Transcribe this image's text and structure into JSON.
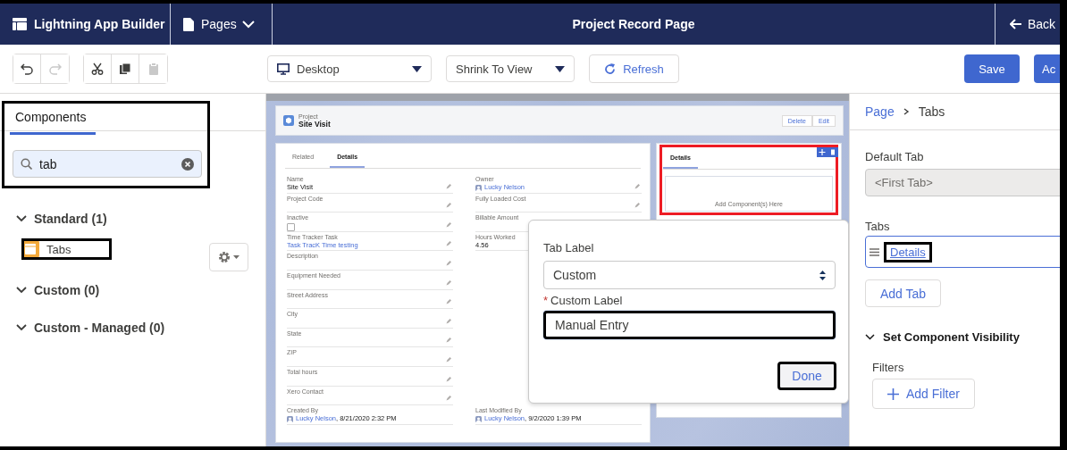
{
  "header": {
    "app_title": "Lightning App Builder",
    "pages_menu": "Pages",
    "page_title": "Project Record Page",
    "back": "Back"
  },
  "toolbar": {
    "undo_disabled": false,
    "redo_disabled": true,
    "cut_disabled": false,
    "copy_disabled": false,
    "paste_disabled": true,
    "device": "Desktop",
    "zoom": "Shrink To View",
    "refresh": "Refresh",
    "save": "Save",
    "activate": "Ac"
  },
  "components_panel": {
    "tab": "Components",
    "highlighted": true,
    "search": {
      "value": "tab"
    },
    "groups": [
      {
        "title": "Standard (1)",
        "expanded": true,
        "items": [
          {
            "label": "Tabs",
            "highlighted": true
          }
        ]
      },
      {
        "title": "Custom (0)",
        "expanded": true
      },
      {
        "title": "Custom - Managed (0)",
        "expanded": true
      }
    ]
  },
  "canvas": {
    "record": {
      "object": "Project",
      "name": "Site Visit",
      "actions": [
        "Delete",
        "Edit"
      ]
    },
    "main_tabs": [
      {
        "label": "Related",
        "selected": false
      },
      {
        "label": "Details",
        "selected": true
      }
    ],
    "rows": [
      {
        "left": {
          "label": "Name",
          "kind": "text",
          "value": "Site Visit",
          "editable": true
        },
        "right": {
          "label": "Owner",
          "kind": "owner",
          "value": "Lucky Nelson",
          "editable": true
        }
      },
      {
        "left": {
          "label": "Project Code",
          "kind": "text",
          "editable": true
        },
        "right": {
          "label": "Fully Loaded Cost",
          "kind": "text",
          "editable": true
        }
      },
      {
        "left": {
          "label": "Inactive",
          "kind": "checkbox",
          "checked": false,
          "editable": true
        },
        "right": {
          "label": "Billable Amount",
          "kind": "text"
        }
      },
      {
        "left": {
          "label": "Time Tracker Task",
          "kind": "link",
          "value": "Task TracK Time testing",
          "editable": true
        },
        "right": {
          "label": "Hours Worked",
          "kind": "text",
          "value": "4.56"
        }
      },
      {
        "left": {
          "label": "Description",
          "kind": "text",
          "editable": true
        }
      },
      {
        "left": {
          "label": "Equipment Needed",
          "kind": "text",
          "editable": true
        }
      },
      {
        "left": {
          "label": "Street Address",
          "kind": "text",
          "editable": true
        }
      },
      {
        "left": {
          "label": "City",
          "kind": "text",
          "editable": true
        }
      },
      {
        "left": {
          "label": "State",
          "kind": "text",
          "editable": true
        }
      },
      {
        "left": {
          "label": "ZIP",
          "kind": "text",
          "editable": true
        }
      },
      {
        "left": {
          "label": "Total hours",
          "kind": "text",
          "editable": true
        }
      },
      {
        "left": {
          "label": "Xero Contact",
          "kind": "text",
          "editable": true
        }
      },
      {
        "left": {
          "label": "Created By",
          "kind": "owner",
          "value": "Lucky Nelson",
          "detail": ", 8/21/2020 2:32 PM",
          "editable": false
        },
        "right": {
          "label": "Last Modified By",
          "kind": "owner",
          "value": "Lucky Nelson",
          "detail": ", 9/2/2020 1:39 PM",
          "editable": false
        }
      }
    ],
    "side_tabs": {
      "tabs": [
        {
          "label": "Details",
          "selected": true
        }
      ],
      "drop_zone": "Add Component(s) Here",
      "highlighted": true
    }
  },
  "popover": {
    "tab_label": {
      "label": "Tab Label",
      "value": "Custom"
    },
    "custom_label": {
      "required_mark": "*",
      "label": "Custom Label",
      "value": "Manual Entry",
      "highlighted": true
    },
    "done": {
      "label": "Done",
      "highlighted": true
    }
  },
  "properties": {
    "breadcrumb": [
      "Page",
      "Tabs"
    ],
    "default_tab": {
      "label": "Default Tab",
      "value": "<First Tab>",
      "disabled": true
    },
    "tabs": {
      "label": "Tabs",
      "items": [
        {
          "label": "Details",
          "selected": true,
          "highlighted": true
        }
      ]
    },
    "add_tab": "Add Tab",
    "visibility": {
      "title": "Set Component Visibility",
      "expanded": true,
      "filters_label": "Filters",
      "add_filter": "Add Filter"
    }
  }
}
